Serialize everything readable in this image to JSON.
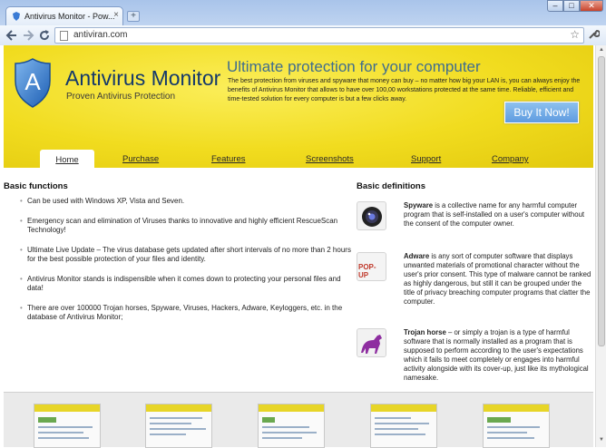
{
  "browser": {
    "tab_title": "Antivirus Monitor - Pow...",
    "tab_close": "×",
    "new_tab": "+",
    "url": "antiviran.com",
    "window_min": "–",
    "window_max": "□",
    "window_close": "✕"
  },
  "header": {
    "logo_letter": "A",
    "title": "Antivirus Monitor",
    "subtitle": "Proven Antivirus Protection",
    "tagline": "Ultimate protection for your computer",
    "description": "The best protection from viruses and spyware that money can buy – no matter how big your LAN is, you can always enjoy the benefits of Antivirus Monitor that allows to have over 100,00 workstations protected at the same time. Reliable, efficient and time-tested solution for every computer is but a few clicks away.",
    "buy_label": "Buy It Now!"
  },
  "menu": {
    "home": "Home",
    "purchase": "Purchase",
    "features": "Features",
    "screenshots": "Screenshots",
    "support": "Support",
    "company": "Company"
  },
  "basic_functions": {
    "heading": "Basic functions",
    "items": [
      "Can be used with Windows XP, Vista and Seven.",
      "Emergency scan and elimination of Viruses thanks to innovative and highly efficient RescueScan Technology!",
      "Ultimate Live Update – The virus database gets updated after short intervals of no more than 2 hours for the best possible protection of your files and identity.",
      "Antivirus Monitor stands is indispensible when it comes down to protecting your personal files and data!",
      "There are over 100000 Trojan horses, Spyware, Viruses, Hackers, Adware, Keyloggers, etc. in the database of Antivirus Monitor;"
    ]
  },
  "basic_definitions": {
    "heading": "Basic definitions",
    "spyware": {
      "term": "Spyware",
      "text": " is a collective name for any harmful computer program that is self-installed on a user's computer without the consent of the computer owner."
    },
    "adware": {
      "term": "Adware",
      "icon_label": "POP-UP",
      "text": " is any sort of computer software that displays unwanted materials of promotional character without the user's prior consent. This type of malware cannot be ranked as highly dangerous, but still it can be grouped under the title of privacy breaching computer programs that clatter the computer."
    },
    "trojan": {
      "term": "Trojan horse",
      "text": " – or simply a trojan is a type of harmful software that is normally installed as a program that is supposed to perform according to the user's expectations which it fails to meet completely or engages into harmful activity alongside with its cover-up, just like its mythological namesake."
    }
  },
  "colors": {
    "header_yellow": "#f1dc1f",
    "title_blue": "#14396b",
    "tagline_blue": "#3f6d8e",
    "buy_button": "#6aa6e6"
  },
  "icons": [
    "page-icon",
    "back-icon",
    "forward-icon",
    "reload-icon",
    "star-icon",
    "wrench-icon",
    "shield-logo-icon",
    "webcam-icon",
    "popup-icon",
    "horse-icon"
  ]
}
